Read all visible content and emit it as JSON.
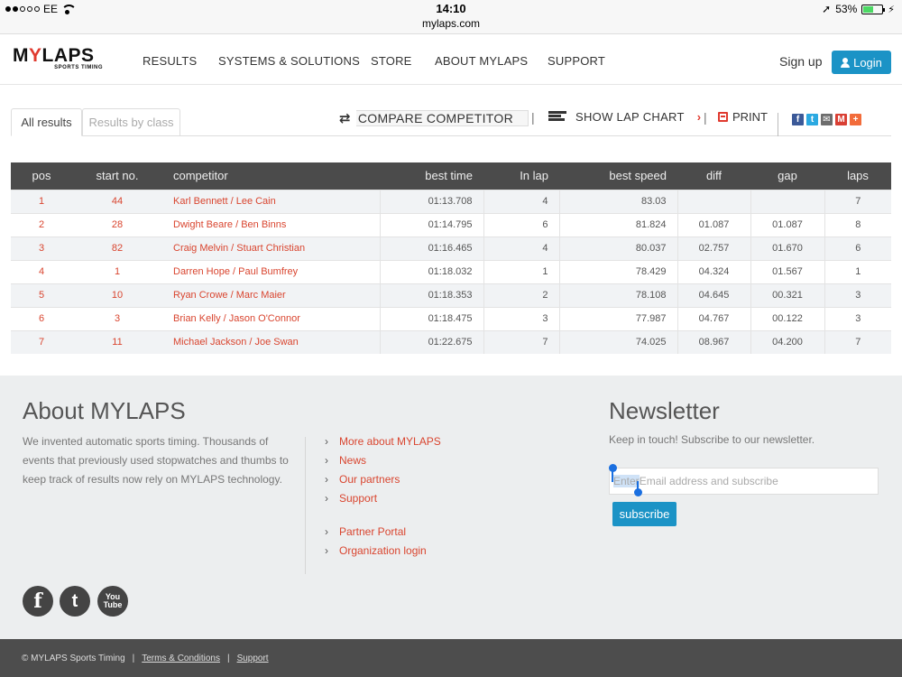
{
  "status_bar": {
    "carrier": "EE",
    "time": "14:10",
    "url": "mylaps.com",
    "battery": "53%",
    "battery_level": 0.53
  },
  "header": {
    "logo_main_a": "M",
    "logo_main_b": "Y",
    "logo_main_c": "LAPS",
    "logo_sub": "SPORTS TIMING",
    "nav": [
      "RESULTS",
      "SYSTEMS & SOLUTIONS",
      "STORE",
      "ABOUT MYLAPS",
      "SUPPORT"
    ],
    "signup": "Sign up",
    "login": "Login"
  },
  "tabs": {
    "all_results": "All results",
    "results_by_class": "Results by class"
  },
  "toolbar": {
    "compare": "COMPARE COMPETITOR",
    "lap_chart": "SHOW LAP CHART",
    "print": "PRINT",
    "separator": "|"
  },
  "share_icons": [
    {
      "name": "facebook-share-icon",
      "glyph": "f",
      "color": "#3b5998"
    },
    {
      "name": "twitter-share-icon",
      "glyph": "t",
      "color": "#2ba9e1"
    },
    {
      "name": "email-share-icon",
      "glyph": "✉",
      "color": "#6d6d6d"
    },
    {
      "name": "gmail-share-icon",
      "glyph": "M",
      "color": "#d93f34"
    },
    {
      "name": "more-share-icon",
      "glyph": "+",
      "color": "#f26c3b"
    }
  ],
  "results_table": {
    "columns": [
      "pos",
      "start no.",
      "competitor",
      "best time",
      "In lap",
      "best speed",
      "diff",
      "gap",
      "laps"
    ],
    "rows": [
      [
        "1",
        "44",
        "Karl Bennett / Lee Cain",
        "01:13.708",
        "4",
        "83.03",
        "",
        "",
        "7"
      ],
      [
        "2",
        "28",
        "Dwight Beare / Ben Binns",
        "01:14.795",
        "6",
        "81.824",
        "01.087",
        "01.087",
        "8"
      ],
      [
        "3",
        "82",
        "Craig Melvin / Stuart Christian",
        "01:16.465",
        "4",
        "80.037",
        "02.757",
        "01.670",
        "6"
      ],
      [
        "4",
        "1",
        "Darren Hope / Paul Bumfrey",
        "01:18.032",
        "1",
        "78.429",
        "04.324",
        "01.567",
        "1"
      ],
      [
        "5",
        "10",
        "Ryan Crowe / Marc Maier",
        "01:18.353",
        "2",
        "78.108",
        "04.645",
        "00.321",
        "3"
      ],
      [
        "6",
        "3",
        "Brian Kelly / Jason O'Connor",
        "01:18.475",
        "3",
        "77.987",
        "04.767",
        "00.122",
        "3"
      ],
      [
        "7",
        "11",
        "Michael Jackson / Joe Swan",
        "01:22.675",
        "7",
        "74.025",
        "08.967",
        "04.200",
        "7"
      ]
    ]
  },
  "footer": {
    "about_title": "About MYLAPS",
    "about_text": "We invented automatic sports timing. Thousands of events that previously used stopwatches and thumbs to keep track of results now rely on MYLAPS technology.",
    "links_group1": [
      "More about MYLAPS",
      "News",
      "Our partners",
      "Support"
    ],
    "links_group2": [
      "Partner Portal",
      "Organization login"
    ],
    "newsletter_title": "Newsletter",
    "newsletter_text": "Keep in touch! Subscribe to our newsletter.",
    "newsletter_selected": "Enter",
    "newsletter_rest": " Email address and subscribe",
    "subscribe": "subscribe",
    "social": [
      "f",
      "t",
      "You Tube"
    ]
  },
  "bottom_bar": {
    "copyright": "© MYLAPS Sports Timing",
    "terms": "Terms & Conditions",
    "support": "Support",
    "separator": "|"
  },
  "colors": {
    "accent_red": "#d9452f",
    "button_blue": "#1b93c6",
    "table_header": "#4b4b4b"
  }
}
